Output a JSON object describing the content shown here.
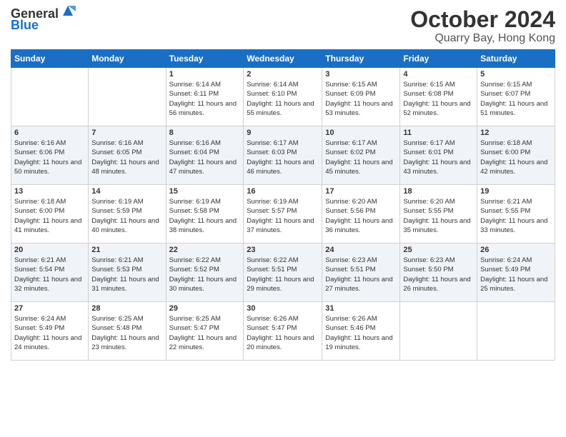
{
  "header": {
    "logo": {
      "line1": "General",
      "line2": "Blue"
    },
    "title": "October 2024",
    "subtitle": "Quarry Bay, Hong Kong"
  },
  "weekdays": [
    "Sunday",
    "Monday",
    "Tuesday",
    "Wednesday",
    "Thursday",
    "Friday",
    "Saturday"
  ],
  "weeks": [
    [
      {
        "day": "",
        "sunrise": "",
        "sunset": "",
        "daylight": ""
      },
      {
        "day": "",
        "sunrise": "",
        "sunset": "",
        "daylight": ""
      },
      {
        "day": "1",
        "sunrise": "Sunrise: 6:14 AM",
        "sunset": "Sunset: 6:11 PM",
        "daylight": "Daylight: 11 hours and 56 minutes."
      },
      {
        "day": "2",
        "sunrise": "Sunrise: 6:14 AM",
        "sunset": "Sunset: 6:10 PM",
        "daylight": "Daylight: 11 hours and 55 minutes."
      },
      {
        "day": "3",
        "sunrise": "Sunrise: 6:15 AM",
        "sunset": "Sunset: 6:09 PM",
        "daylight": "Daylight: 11 hours and 53 minutes."
      },
      {
        "day": "4",
        "sunrise": "Sunrise: 6:15 AM",
        "sunset": "Sunset: 6:08 PM",
        "daylight": "Daylight: 11 hours and 52 minutes."
      },
      {
        "day": "5",
        "sunrise": "Sunrise: 6:15 AM",
        "sunset": "Sunset: 6:07 PM",
        "daylight": "Daylight: 11 hours and 51 minutes."
      }
    ],
    [
      {
        "day": "6",
        "sunrise": "Sunrise: 6:16 AM",
        "sunset": "Sunset: 6:06 PM",
        "daylight": "Daylight: 11 hours and 50 minutes."
      },
      {
        "day": "7",
        "sunrise": "Sunrise: 6:16 AM",
        "sunset": "Sunset: 6:05 PM",
        "daylight": "Daylight: 11 hours and 48 minutes."
      },
      {
        "day": "8",
        "sunrise": "Sunrise: 6:16 AM",
        "sunset": "Sunset: 6:04 PM",
        "daylight": "Daylight: 11 hours and 47 minutes."
      },
      {
        "day": "9",
        "sunrise": "Sunrise: 6:17 AM",
        "sunset": "Sunset: 6:03 PM",
        "daylight": "Daylight: 11 hours and 46 minutes."
      },
      {
        "day": "10",
        "sunrise": "Sunrise: 6:17 AM",
        "sunset": "Sunset: 6:02 PM",
        "daylight": "Daylight: 11 hours and 45 minutes."
      },
      {
        "day": "11",
        "sunrise": "Sunrise: 6:17 AM",
        "sunset": "Sunset: 6:01 PM",
        "daylight": "Daylight: 11 hours and 43 minutes."
      },
      {
        "day": "12",
        "sunrise": "Sunrise: 6:18 AM",
        "sunset": "Sunset: 6:00 PM",
        "daylight": "Daylight: 11 hours and 42 minutes."
      }
    ],
    [
      {
        "day": "13",
        "sunrise": "Sunrise: 6:18 AM",
        "sunset": "Sunset: 6:00 PM",
        "daylight": "Daylight: 11 hours and 41 minutes."
      },
      {
        "day": "14",
        "sunrise": "Sunrise: 6:19 AM",
        "sunset": "Sunset: 5:59 PM",
        "daylight": "Daylight: 11 hours and 40 minutes."
      },
      {
        "day": "15",
        "sunrise": "Sunrise: 6:19 AM",
        "sunset": "Sunset: 5:58 PM",
        "daylight": "Daylight: 11 hours and 38 minutes."
      },
      {
        "day": "16",
        "sunrise": "Sunrise: 6:19 AM",
        "sunset": "Sunset: 5:57 PM",
        "daylight": "Daylight: 11 hours and 37 minutes."
      },
      {
        "day": "17",
        "sunrise": "Sunrise: 6:20 AM",
        "sunset": "Sunset: 5:56 PM",
        "daylight": "Daylight: 11 hours and 36 minutes."
      },
      {
        "day": "18",
        "sunrise": "Sunrise: 6:20 AM",
        "sunset": "Sunset: 5:55 PM",
        "daylight": "Daylight: 11 hours and 35 minutes."
      },
      {
        "day": "19",
        "sunrise": "Sunrise: 6:21 AM",
        "sunset": "Sunset: 5:55 PM",
        "daylight": "Daylight: 11 hours and 33 minutes."
      }
    ],
    [
      {
        "day": "20",
        "sunrise": "Sunrise: 6:21 AM",
        "sunset": "Sunset: 5:54 PM",
        "daylight": "Daylight: 11 hours and 32 minutes."
      },
      {
        "day": "21",
        "sunrise": "Sunrise: 6:21 AM",
        "sunset": "Sunset: 5:53 PM",
        "daylight": "Daylight: 11 hours and 31 minutes."
      },
      {
        "day": "22",
        "sunrise": "Sunrise: 6:22 AM",
        "sunset": "Sunset: 5:52 PM",
        "daylight": "Daylight: 11 hours and 30 minutes."
      },
      {
        "day": "23",
        "sunrise": "Sunrise: 6:22 AM",
        "sunset": "Sunset: 5:51 PM",
        "daylight": "Daylight: 11 hours and 29 minutes."
      },
      {
        "day": "24",
        "sunrise": "Sunrise: 6:23 AM",
        "sunset": "Sunset: 5:51 PM",
        "daylight": "Daylight: 11 hours and 27 minutes."
      },
      {
        "day": "25",
        "sunrise": "Sunrise: 6:23 AM",
        "sunset": "Sunset: 5:50 PM",
        "daylight": "Daylight: 11 hours and 26 minutes."
      },
      {
        "day": "26",
        "sunrise": "Sunrise: 6:24 AM",
        "sunset": "Sunset: 5:49 PM",
        "daylight": "Daylight: 11 hours and 25 minutes."
      }
    ],
    [
      {
        "day": "27",
        "sunrise": "Sunrise: 6:24 AM",
        "sunset": "Sunset: 5:49 PM",
        "daylight": "Daylight: 11 hours and 24 minutes."
      },
      {
        "day": "28",
        "sunrise": "Sunrise: 6:25 AM",
        "sunset": "Sunset: 5:48 PM",
        "daylight": "Daylight: 11 hours and 23 minutes."
      },
      {
        "day": "29",
        "sunrise": "Sunrise: 6:25 AM",
        "sunset": "Sunset: 5:47 PM",
        "daylight": "Daylight: 11 hours and 22 minutes."
      },
      {
        "day": "30",
        "sunrise": "Sunrise: 6:26 AM",
        "sunset": "Sunset: 5:47 PM",
        "daylight": "Daylight: 11 hours and 20 minutes."
      },
      {
        "day": "31",
        "sunrise": "Sunrise: 6:26 AM",
        "sunset": "Sunset: 5:46 PM",
        "daylight": "Daylight: 11 hours and 19 minutes."
      },
      {
        "day": "",
        "sunrise": "",
        "sunset": "",
        "daylight": ""
      },
      {
        "day": "",
        "sunrise": "",
        "sunset": "",
        "daylight": ""
      }
    ]
  ]
}
